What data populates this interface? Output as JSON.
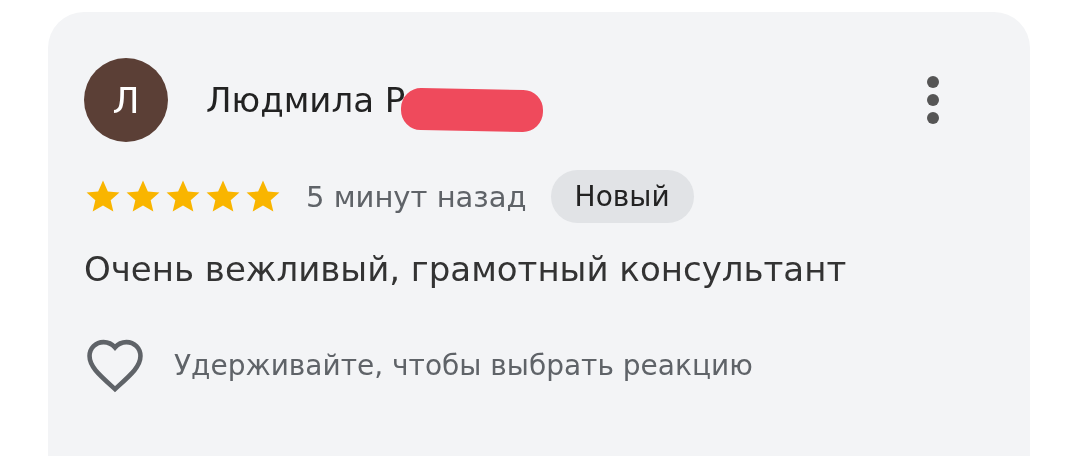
{
  "review": {
    "avatar_letter": "Л",
    "author": "Людмила Р",
    "stars": 5,
    "time": "5 минут назад",
    "badge": "Новый",
    "text": "Очень вежливый, грамотный консультант",
    "reaction_hint": "Удерживайте, чтобы выбрать реакцию"
  }
}
